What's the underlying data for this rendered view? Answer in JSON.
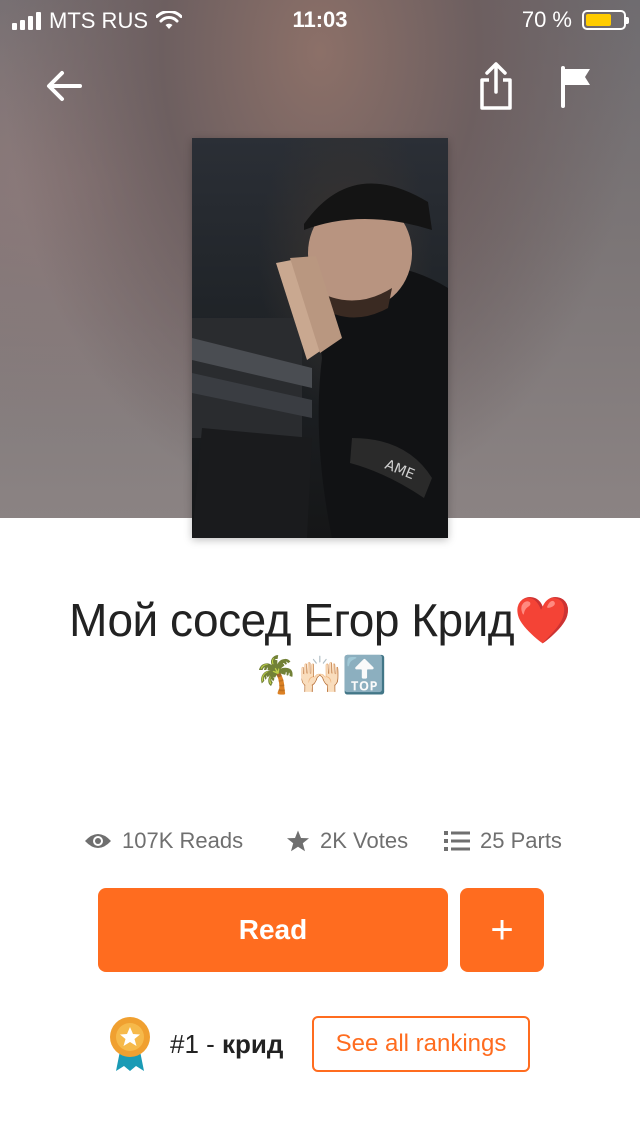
{
  "status_bar": {
    "carrier": "MTS RUS",
    "time": "11:03",
    "battery_percent": "70 %",
    "battery_level": 0.7
  },
  "nav": {
    "back_icon": "arrow-left-icon",
    "share_icon": "share-icon",
    "flag_icon": "flag-icon"
  },
  "story": {
    "title": "Мой сосед Егор Крид❤️",
    "title_emojis": "🌴🙌🏻🔝",
    "cover_icon": "cover-photo"
  },
  "stats": {
    "reads": "107K Reads",
    "votes": "2K Votes",
    "parts": "25 Parts"
  },
  "actions": {
    "read_label": "Read",
    "add_label": "+"
  },
  "ranking": {
    "rank": "#1",
    "separator": " - ",
    "tag": "крид",
    "see_all_label": "See all rankings"
  },
  "colors": {
    "accent": "#ff6c1f",
    "battery": "#ffcc00",
    "text": "#222222",
    "muted": "#6f6f6f"
  }
}
